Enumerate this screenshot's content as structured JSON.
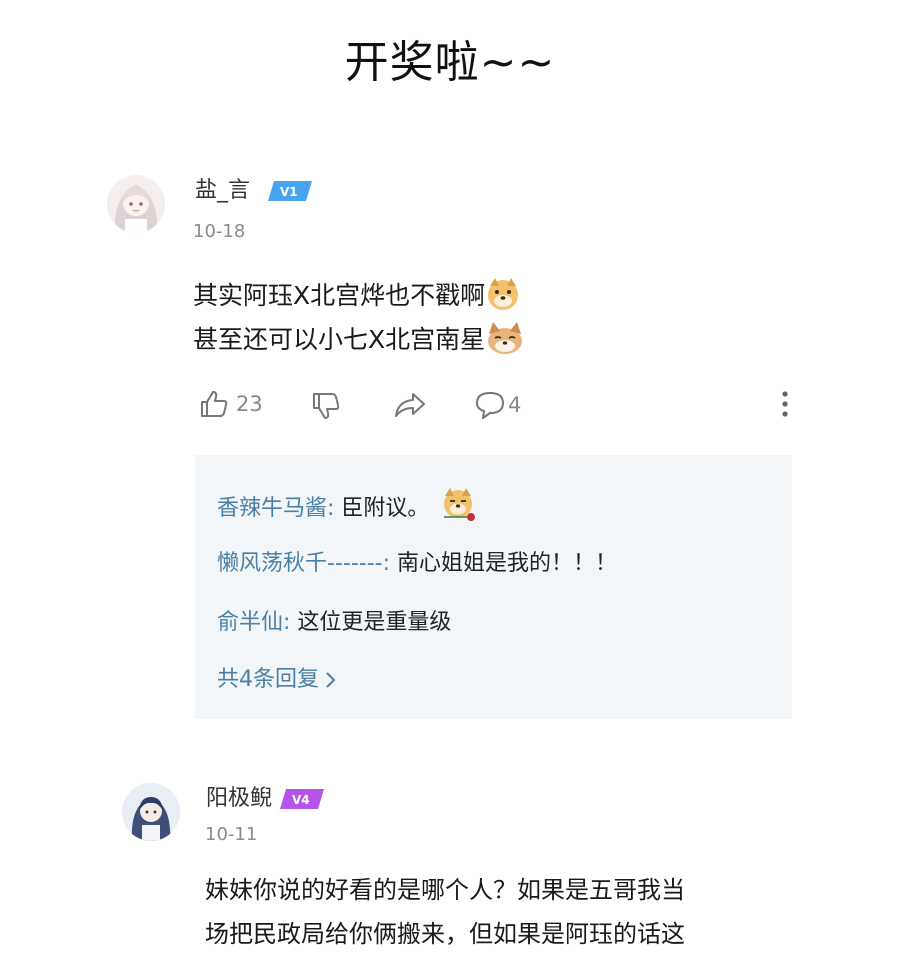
{
  "page": {
    "title": "开奖啦~~"
  },
  "comments": [
    {
      "username": "盐_言",
      "level": "V1",
      "level_color": "#4aa3ee",
      "date": "10-18",
      "lines": [
        "其实阿珏X北宫烨也不戳啊",
        "甚至还可以小七X北宫南星"
      ],
      "emoji_icons": [
        "doge-emoji",
        "cat-doge-emoji"
      ],
      "like_count": "23",
      "comment_count": "4",
      "replies": [
        {
          "author": "香辣牛马酱",
          "sep": ":",
          "text": " 臣附议。",
          "emoji_icon": "doge-rose-emoji"
        },
        {
          "author": "懒风荡秋千-------",
          "sep": ":",
          "text": " 南心姐姐是我的！！！"
        },
        {
          "author": "俞半仙",
          "sep": ":",
          "text": " 这位更是重量级"
        }
      ],
      "more_replies_label": "共4条回复"
    },
    {
      "username": "阳极鲵",
      "level": "V4",
      "level_color": "#b455e8",
      "date": "10-11",
      "lines": [
        "妹妹你说的好看的是哪个人？如果是五哥我当",
        "场把民政局给你俩搬来，但如果是阿珏的话这"
      ]
    }
  ],
  "colors": {
    "link_blue": "#4a7fa6",
    "reply_bg": "#f3f6f9",
    "muted": "#8a8a8a"
  },
  "icons": {
    "like": "thumbs-up-icon",
    "dislike": "thumbs-down-icon",
    "share": "share-arrow-icon",
    "comment": "comment-bubble-icon",
    "more": "more-vertical-icon",
    "chevron": "chevron-right-icon"
  }
}
